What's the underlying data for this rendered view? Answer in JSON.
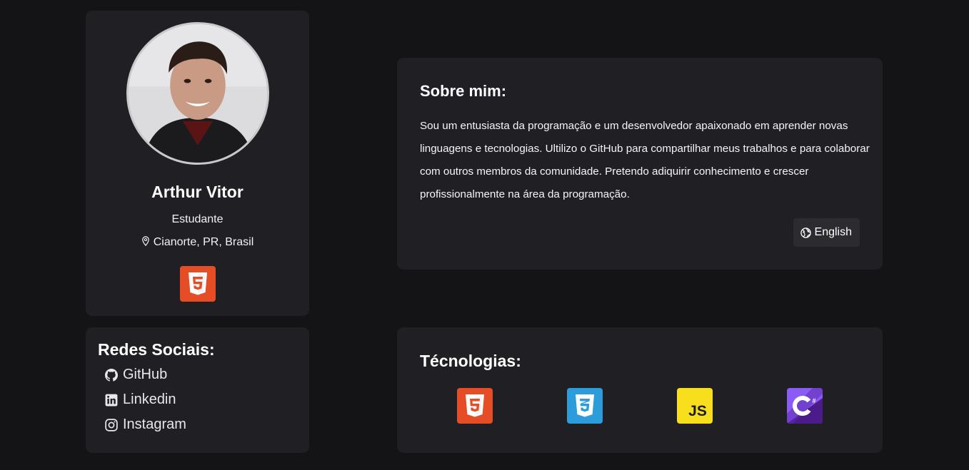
{
  "profile": {
    "name": "Arthur Vitor",
    "role": "Estudante",
    "location": "Cianorte, PR, Brasil",
    "icon": "map-pin-icon"
  },
  "social": {
    "title": "Redes Sociais:",
    "links": [
      {
        "label": "GitHub",
        "icon": "github-icon"
      },
      {
        "label": "Linkedin",
        "icon": "linkedin-icon"
      },
      {
        "label": "Instagram",
        "icon": "instagram-icon"
      }
    ]
  },
  "about": {
    "title": "Sobre mim:",
    "text": "Sou um entusiasta da programação e um desenvolvedor apaixonado em aprender novas linguagens e tecnologias. Ultilizo o GitHub para compartilhar meus trabalhos e para colaborar com outros membros da comunidade. Pretendo adiquirir conhecimento e crescer profissionalmente na área da programação.",
    "language_button": "English",
    "language_icon": "globe-icon"
  },
  "technologies": {
    "title": "Técnologias:",
    "items": [
      {
        "label": "5",
        "icon": "html5-icon",
        "color": "#e44d26"
      },
      {
        "label": "3",
        "icon": "css3-icon",
        "color": "#2d9cdb"
      },
      {
        "label": "JS",
        "icon": "javascript-icon",
        "color": "#f7df1e"
      },
      {
        "label": "C#",
        "icon": "csharp-icon",
        "color": "#68217a"
      }
    ]
  },
  "colors": {
    "background": "#141416",
    "card": "#202024",
    "button": "#2c2c30"
  }
}
